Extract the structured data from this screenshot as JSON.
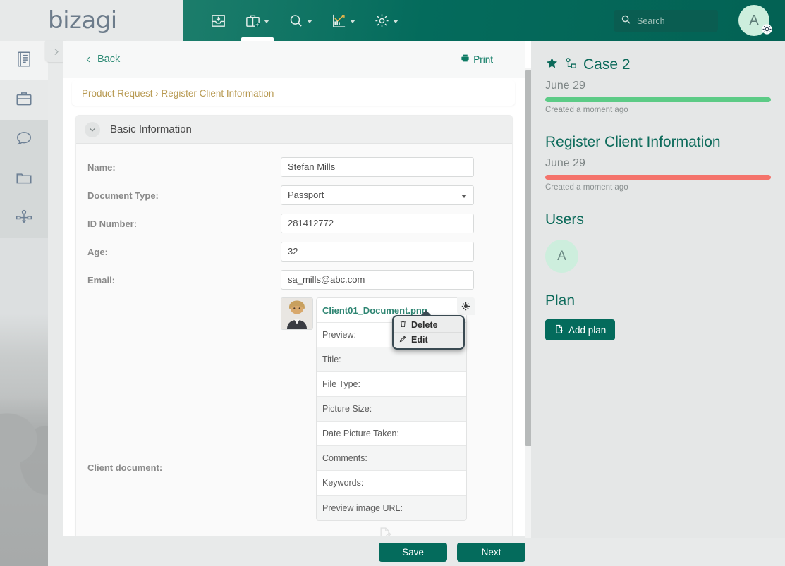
{
  "app": {
    "logo_text": "bizagi",
    "brand_color": "#046b5c",
    "accent_gold": "#b89a52"
  },
  "topbar": {
    "nav_items": [
      {
        "name": "inbox-icon",
        "label": "Inbox",
        "has_caret": false,
        "active": false
      },
      {
        "name": "new-case-icon",
        "label": "New case",
        "has_caret": true,
        "active": true
      },
      {
        "name": "search-icon",
        "label": "Search",
        "has_caret": true,
        "active": false
      },
      {
        "name": "analytics-icon",
        "label": "Analytics",
        "has_caret": true,
        "active": false
      },
      {
        "name": "settings-icon",
        "label": "Admin",
        "has_caret": true,
        "active": false
      }
    ],
    "search": {
      "placeholder": "Search",
      "value": ""
    },
    "avatar_initial": "A"
  },
  "sidebar": {
    "items": [
      {
        "name": "sidebar-item-forms",
        "icon": "form-list-icon",
        "active": true
      },
      {
        "name": "sidebar-item-cases",
        "icon": "briefcase-icon",
        "active": false
      },
      {
        "name": "sidebar-item-comments",
        "icon": "chat-bubble-icon",
        "active": false
      },
      {
        "name": "sidebar-item-documents",
        "icon": "folder-icon",
        "active": false
      },
      {
        "name": "sidebar-item-process",
        "icon": "process-diagram-icon",
        "active": false
      }
    ]
  },
  "center": {
    "back_label": "Back",
    "print_label": "Print",
    "breadcrumb": "Product Request › Register Client Information",
    "section_title": "Basic Information",
    "fields": [
      {
        "label": "Name:",
        "value": "Stefan Mills",
        "type": "text",
        "name": "name-field"
      },
      {
        "label": "Document Type:",
        "value": "Passport",
        "type": "select",
        "name": "document-type-select"
      },
      {
        "label": "ID Number:",
        "value": "281412772",
        "type": "text",
        "name": "id-number-field"
      },
      {
        "label": "Age:",
        "value": "32",
        "type": "text",
        "name": "age-field"
      },
      {
        "label": "Email:",
        "value": "sa_mills@abc.com",
        "type": "text",
        "name": "email-field"
      }
    ],
    "document": {
      "label": "Client document:",
      "file_name": "Client01_Document.png",
      "meta_rows": [
        "Preview:",
        "Title:",
        "File Type:",
        "Picture Size:",
        "Date Picture Taken:",
        "Comments:",
        "Keywords:",
        "Preview image URL:"
      ]
    },
    "context_menu": {
      "items": [
        {
          "label": "Delete",
          "icon": "trash-icon",
          "name": "context-menu-delete"
        },
        {
          "label": "Edit",
          "icon": "pencil-icon",
          "name": "context-menu-edit"
        }
      ]
    }
  },
  "actions": {
    "save_label": "Save",
    "next_label": "Next"
  },
  "right_panel": {
    "case_title": "Case 2",
    "case_date": "June 29",
    "case_progress_color": "#5ccb86",
    "case_sub": "Created a moment ago",
    "task_title": "Register Client Information",
    "task_date": "June 29",
    "task_progress_color": "#f4736b",
    "task_sub": "Created a moment ago",
    "users_heading": "Users",
    "user_initial": "A",
    "plan_heading": "Plan",
    "add_plan_label": "Add plan"
  }
}
